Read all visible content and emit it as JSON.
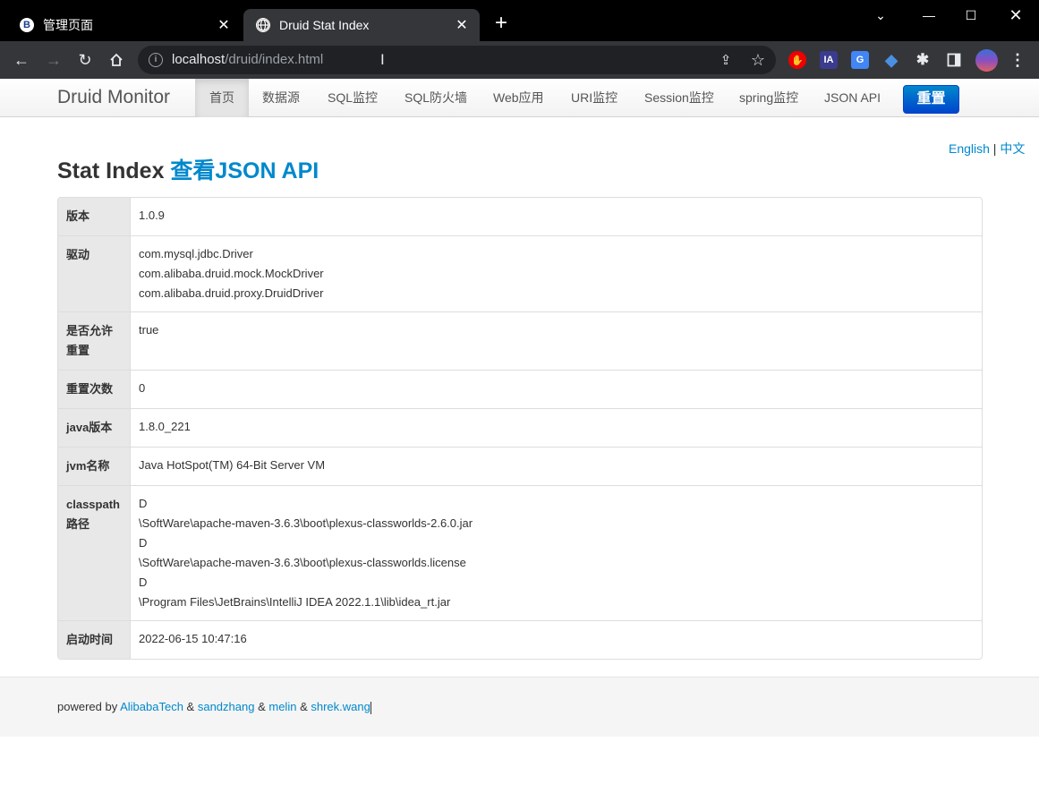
{
  "browser": {
    "tabs": [
      {
        "title": "管理页面",
        "favicon": "B",
        "active": false
      },
      {
        "title": "Druid Stat Index",
        "favicon": "globe-icon",
        "active": true
      }
    ],
    "url_host": "localhost",
    "url_path": "/druid/index.html"
  },
  "navbar": {
    "brand": "Druid Monitor",
    "items": [
      "首页",
      "数据源",
      "SQL监控",
      "SQL防火墙",
      "Web应用",
      "URI监控",
      "Session监控",
      "spring监控",
      "JSON API"
    ],
    "active_index": 0,
    "reset_label": "重置"
  },
  "lang": {
    "english": "English",
    "sep": " | ",
    "chinese": "中文"
  },
  "heading": {
    "title": "Stat Index ",
    "link": "查看JSON API"
  },
  "table": [
    {
      "label": "版本",
      "values": [
        "1.0.9"
      ]
    },
    {
      "label": "驱动",
      "values": [
        "com.mysql.jdbc.Driver",
        "com.alibaba.druid.mock.MockDriver",
        "com.alibaba.druid.proxy.DruidDriver"
      ]
    },
    {
      "label": "是否允许重置",
      "values": [
        "true"
      ]
    },
    {
      "label": "重置次数",
      "values": [
        "0"
      ]
    },
    {
      "label": "java版本",
      "values": [
        "1.8.0_221"
      ]
    },
    {
      "label": "jvm名称",
      "values": [
        "Java HotSpot(TM) 64-Bit Server VM"
      ]
    },
    {
      "label": "classpath路径",
      "values": [
        "D",
        "\\SoftWare\\apache-maven-3.6.3\\boot\\plexus-classworlds-2.6.0.jar",
        "D",
        "\\SoftWare\\apache-maven-3.6.3\\boot\\plexus-classworlds.license",
        "D",
        "\\Program Files\\JetBrains\\IntelliJ IDEA 2022.1.1\\lib\\idea_rt.jar"
      ]
    },
    {
      "label": "启动时间",
      "values": [
        "2022-06-15 10:47:16"
      ]
    }
  ],
  "footer": {
    "prefix": "powered by ",
    "links": [
      "AlibabaTech",
      "sandzhang",
      "melin",
      "shrek.wang"
    ],
    "sep": " & "
  }
}
